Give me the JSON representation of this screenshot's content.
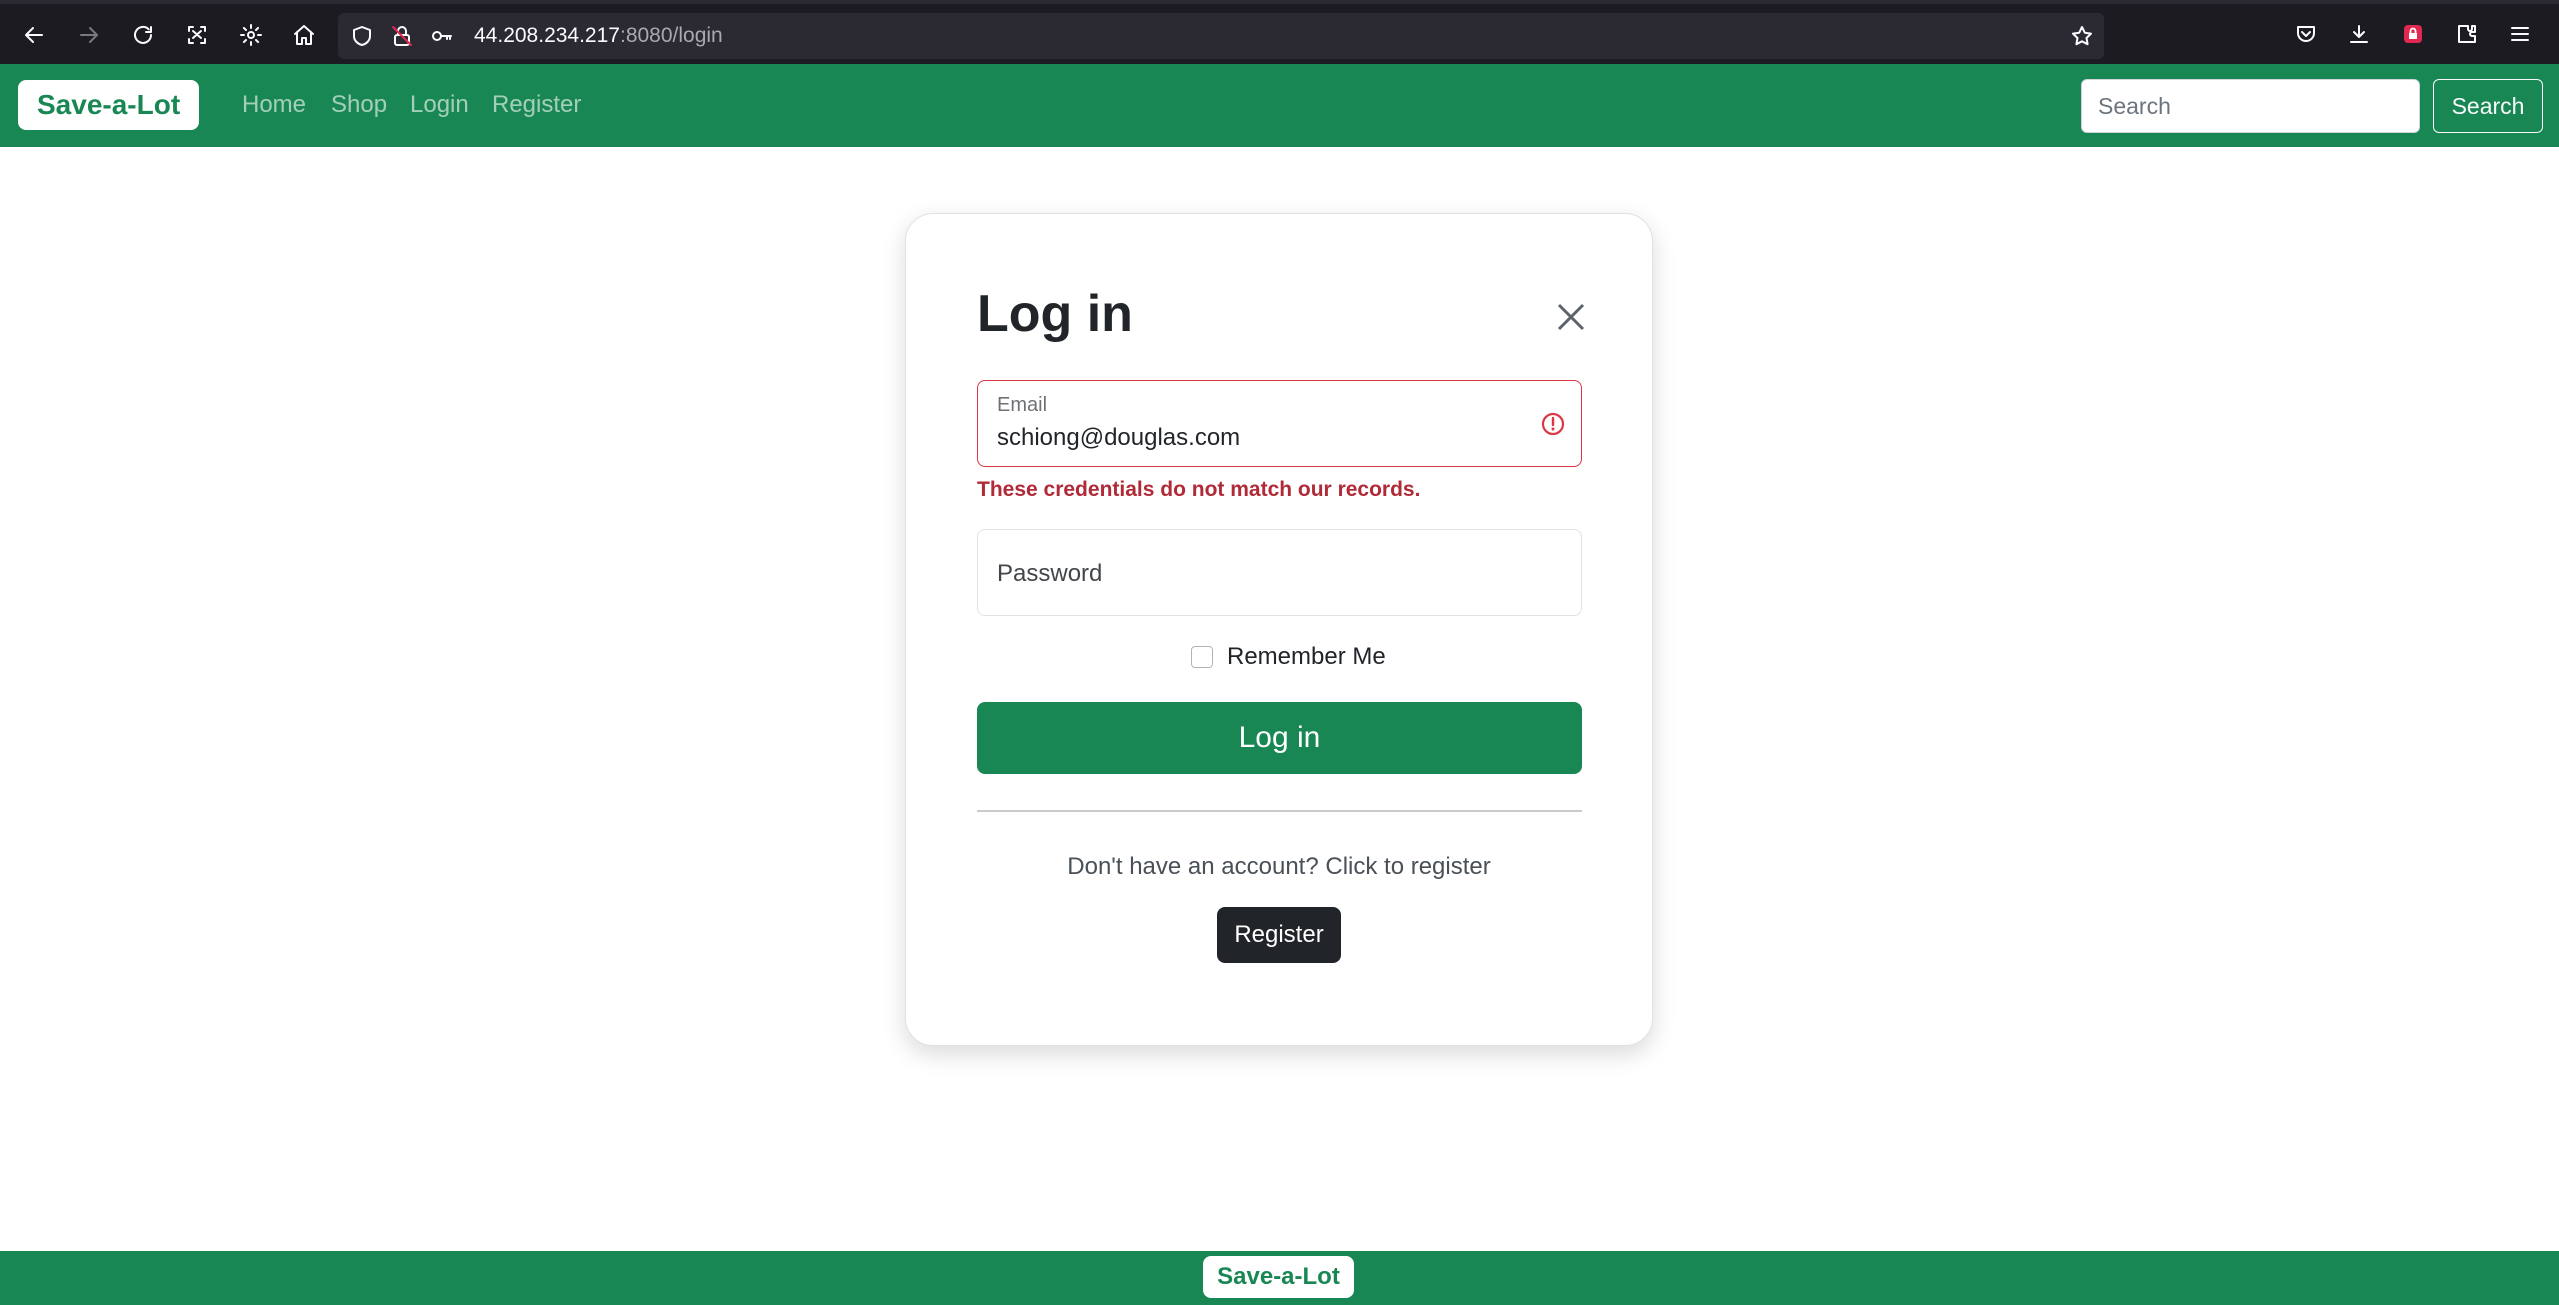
{
  "browser": {
    "url_host": "44.208.234.217",
    "url_rest": ":8080/login",
    "icons": [
      "back-arrow-icon",
      "forward-arrow-icon",
      "reload-icon",
      "screenshot-icon",
      "settings-gear-icon",
      "home-icon",
      "shield-icon",
      "lock-slash-icon",
      "key-icon",
      "bookmark-star-icon",
      "pocket-icon",
      "download-icon",
      "extension-lock-icon",
      "extensions-icon",
      "menu-icon"
    ]
  },
  "navbar": {
    "brand": "Save-a-Lot",
    "links": [
      "Home",
      "Shop",
      "Login",
      "Register"
    ],
    "search_placeholder": "Search",
    "search_button": "Search"
  },
  "login": {
    "title": "Log in",
    "email_label": "Email",
    "email_value": "schiong@douglas.com",
    "error": "These credentials do not match our records.",
    "password_label": "Password",
    "remember_label": "Remember Me",
    "remember_checked": false,
    "submit_label": "Log in",
    "register_prompt": "Don't have an account? Click to register",
    "register_button": "Register"
  },
  "footer": {
    "brand": "Save-a-Lot"
  },
  "colors": {
    "primary": "#198754",
    "error": "#dc3545",
    "dark": "#212529",
    "browser_bg": "#1c1b22"
  }
}
